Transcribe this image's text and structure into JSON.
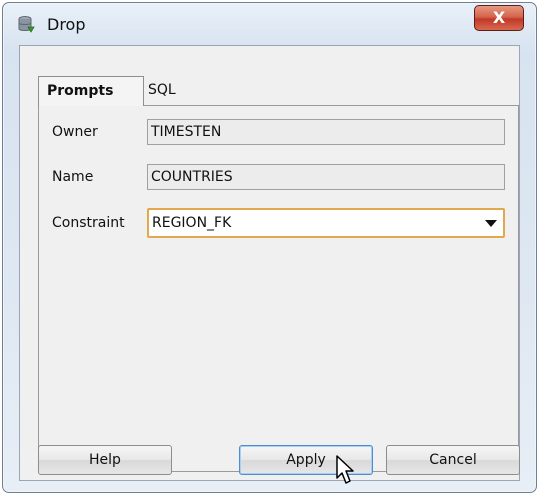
{
  "window": {
    "title": "Drop",
    "close_label": "X"
  },
  "tabs": [
    {
      "label": "Prompts",
      "active": true
    },
    {
      "label": "SQL",
      "active": false
    }
  ],
  "form": {
    "owner": {
      "label": "Owner",
      "value": "TIMESTEN"
    },
    "name": {
      "label": "Name",
      "value": "COUNTRIES"
    },
    "constraint": {
      "label": "Constraint",
      "value": "REGION_FK"
    }
  },
  "buttons": {
    "help": "Help",
    "apply": "Apply",
    "cancel": "Cancel"
  },
  "icons": {
    "title": "database-drop-icon",
    "dropdown": "chevron-down-icon",
    "cursor": "mouse-pointer-icon"
  },
  "colors": {
    "focus_border": "#e4a84c",
    "close_button": "#c2382a",
    "default_button_border": "#4c8ed1"
  }
}
